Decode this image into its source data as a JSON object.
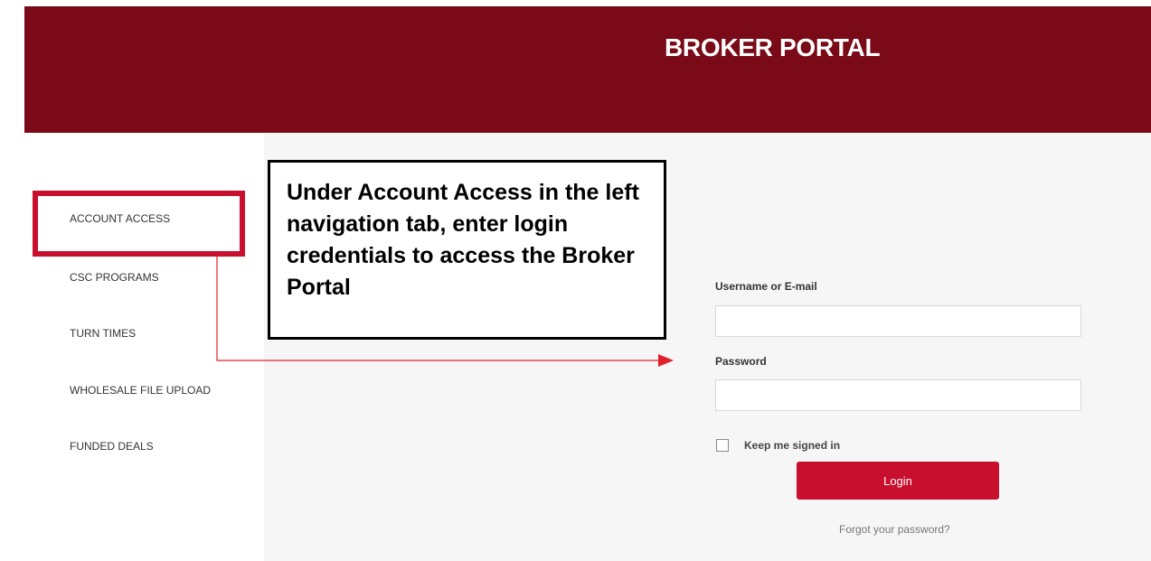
{
  "header": {
    "title": "BROKER PORTAL"
  },
  "sidebar": {
    "items": [
      {
        "label": "ACCOUNT ACCESS"
      },
      {
        "label": "CSC PROGRAMS"
      },
      {
        "label": "TURN TIMES"
      },
      {
        "label": "WHOLESALE FILE UPLOAD"
      },
      {
        "label": "FUNDED DEALS"
      }
    ]
  },
  "callout": {
    "text": "Under Account Access in the left navigation tab, enter login credentials to access the Broker Portal"
  },
  "login_form": {
    "username_label": "Username or E-mail",
    "username_value": "",
    "password_label": "Password",
    "password_value": "",
    "keep_signed_in_label": "Keep me signed in",
    "keep_signed_in_checked": false,
    "login_button_label": "Login",
    "forgot_password_label": "Forgot your password?"
  },
  "colors": {
    "header_background": "#7a0a17",
    "accent": "#c8102e",
    "panel_background": "#f6f6f6"
  }
}
